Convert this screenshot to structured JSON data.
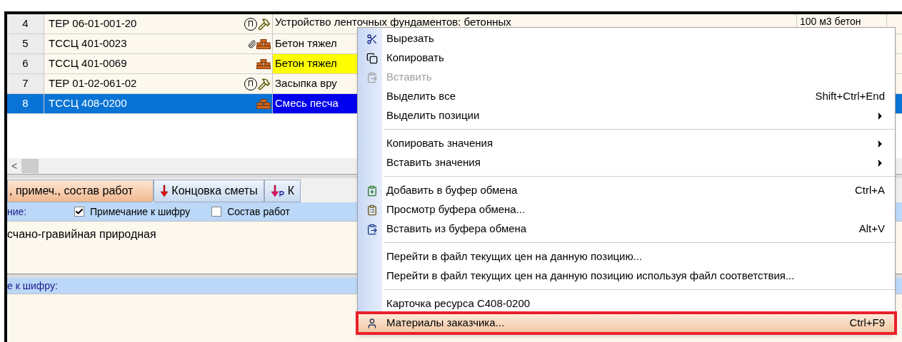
{
  "table": {
    "rows": [
      {
        "num": "4",
        "code": "ТЕР 06-01-001-20",
        "tag": "П",
        "attached": false,
        "kind": "work",
        "name": "Устройство ленточных фундаментов: бетонных",
        "unit": "100 м3 бетон",
        "highlighted": false,
        "selected": false
      },
      {
        "num": "5",
        "code": "ТССЦ 401-0023",
        "attached": true,
        "kind": "material",
        "name": "Бетон тяжел",
        "highlighted": false,
        "selected": false
      },
      {
        "num": "6",
        "code": "ТССЦ 401-0069",
        "attached": false,
        "kind": "material",
        "name": "Бетон тяжел",
        "highlighted": true,
        "selected": false
      },
      {
        "num": "7",
        "code": "ТЕР 01-02-061-02",
        "tag": "П",
        "attached": false,
        "kind": "work",
        "name": "Засыпка вру",
        "highlighted": false,
        "selected": false
      },
      {
        "num": "8",
        "code": "ТССЦ 408-0200",
        "attached": false,
        "kind": "material",
        "name": "Смесь песча",
        "highlighted": false,
        "selected": true
      }
    ],
    "scroll_left": "<"
  },
  "tabs": [
    {
      "label": ", примеч., состав работ",
      "selected": true
    },
    {
      "label": "Концовка сметы",
      "selected": false
    },
    {
      "label": "К",
      "selected": false
    }
  ],
  "notes_bar": {
    "label": "ние:",
    "checkboxes": [
      {
        "label": "Примечание к шифру",
        "checked": true
      },
      {
        "label": "Состав работ",
        "checked": false
      }
    ]
  },
  "notes_text": "счано-гравийная природная",
  "code_note_bar": {
    "label": "е к шифру:"
  },
  "context_menu": {
    "items": [
      {
        "kind": "item",
        "label": "Вырезать",
        "disabled": false,
        "highlighted": false
      },
      {
        "kind": "item",
        "label": "Копировать",
        "disabled": false,
        "highlighted": false
      },
      {
        "kind": "item",
        "label": "Вставить",
        "disabled": true,
        "highlighted": false
      },
      {
        "kind": "item",
        "label": "Выделить все",
        "shortcut": "Shift+Ctrl+End",
        "disabled": false,
        "highlighted": false
      },
      {
        "kind": "submenu",
        "label": "Выделить позиции",
        "disabled": false,
        "highlighted": false
      },
      {
        "kind": "separator"
      },
      {
        "kind": "submenu",
        "label": "Копировать значения",
        "disabled": false,
        "highlighted": false
      },
      {
        "kind": "submenu",
        "label": "Вставить значения",
        "disabled": false,
        "highlighted": false
      },
      {
        "kind": "separator"
      },
      {
        "kind": "item",
        "label": "Добавить в буфер обмена",
        "shortcut": "Ctrl+A",
        "disabled": false,
        "highlighted": false
      },
      {
        "kind": "item",
        "label": "Просмотр буфера обмена...",
        "disabled": false,
        "highlighted": false
      },
      {
        "kind": "item",
        "label": "Вставить из буфера обмена",
        "shortcut": "Alt+V",
        "disabled": false,
        "highlighted": false
      },
      {
        "kind": "separator"
      },
      {
        "kind": "item",
        "label": "Перейти в файл текущих цен на данную позицию...",
        "disabled": false,
        "highlighted": false
      },
      {
        "kind": "item",
        "label": "Перейти в файл текущих цен на данную позицию используя файл соответствия...",
        "disabled": false,
        "highlighted": false
      },
      {
        "kind": "separator"
      },
      {
        "kind": "item",
        "label": "Карточка ресурса С408-0200",
        "disabled": false,
        "highlighted": false
      },
      {
        "kind": "item",
        "label": "Материалы заказчика...",
        "shortcut": "Ctrl+F9",
        "disabled": false,
        "highlighted": true
      }
    ]
  }
}
